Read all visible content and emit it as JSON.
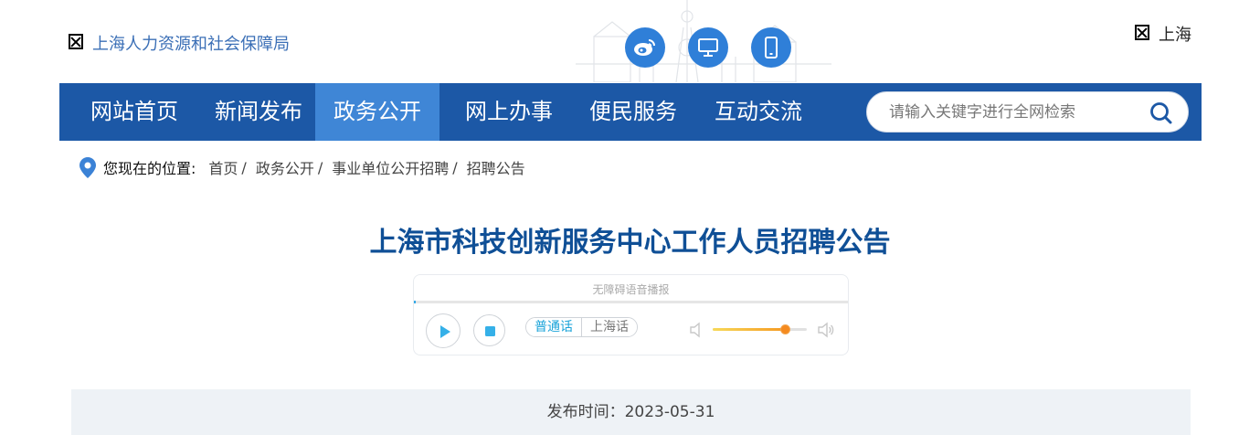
{
  "header": {
    "logo_text": "上海人力资源和社会保障局",
    "city_label": "上海",
    "social": [
      {
        "icon": "weibo-icon"
      },
      {
        "icon": "desktop-icon"
      },
      {
        "icon": "mobile-icon"
      }
    ]
  },
  "nav": {
    "items": [
      {
        "label": "网站首页"
      },
      {
        "label": "新闻发布"
      },
      {
        "label": "政务公开",
        "active": true
      },
      {
        "label": "网上办事"
      },
      {
        "label": "便民服务"
      },
      {
        "label": "互动交流"
      }
    ],
    "search_placeholder": "请输入关键字进行全网检索"
  },
  "breadcrumb": {
    "label": "您现在的位置:",
    "items": [
      "首页",
      "政务公开",
      "事业单位公开招聘",
      "招聘公告"
    ],
    "separator": "/"
  },
  "article": {
    "title": "上海市科技创新服务中心工作人员招聘公告",
    "publish": "发布时间：2023-05-31"
  },
  "player": {
    "caption": "无障碍语音播报",
    "languages": [
      "普通话",
      "上海话"
    ],
    "active_language": "普通话",
    "progress": 0.0,
    "volume": 0.77
  },
  "colors": {
    "nav_bg": "#1c58a6",
    "nav_active": "#3f86d6",
    "title": "#0f4f96",
    "accent": "#33a8e6"
  }
}
